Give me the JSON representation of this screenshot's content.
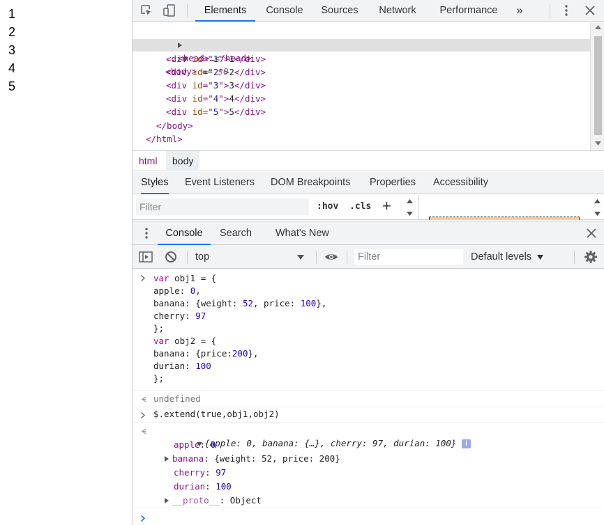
{
  "page": {
    "lines": [
      "1",
      "2",
      "3",
      "4",
      "5"
    ]
  },
  "toolbar": {
    "tabs": [
      "Elements",
      "Console",
      "Sources",
      "Network",
      "Performance"
    ],
    "more": "»"
  },
  "tree": {
    "head_open": "<head>",
    "head_ellipsis": "…",
    "head_close": "</head>",
    "body_dots": "...",
    "body_tag": "<body>",
    "body_eq": " == $0",
    "divs": [
      {
        "id": "1",
        "text": "1"
      },
      {
        "id": "2",
        "text": "2"
      },
      {
        "id": "3",
        "text": "3"
      },
      {
        "id": "4",
        "text": "4"
      },
      {
        "id": "5",
        "text": "5"
      }
    ],
    "body_close": "</body>",
    "html_close": "</html>"
  },
  "breadcrumb": [
    "html",
    "body"
  ],
  "subtabs": [
    "Styles",
    "Event Listeners",
    "DOM Breakpoints",
    "Properties",
    "Accessibility"
  ],
  "styles": {
    "filter_placeholder": "Filter",
    "hov": ":hov",
    "cls": ".cls",
    "plus": "+"
  },
  "drawer": {
    "tabs": [
      "Console",
      "Search",
      "What's New"
    ]
  },
  "console_toolbar": {
    "context": "top",
    "filter_placeholder": "Filter",
    "levels": "Default levels"
  },
  "console": {
    "input1": [
      "var obj1 = {",
      "apple: 0,",
      "banana: {weight: 52, price: 100},",
      "cherry: 97",
      "};",
      "var obj2 = {",
      "banana: {price:200},",
      "durian: 100",
      "};"
    ],
    "result1": "undefined",
    "input2": "$.extend(true,obj1,obj2)",
    "result2_summary": "{apple: 0, banana: {…}, cherry: 97, durian: 100}",
    "result2_props": [
      {
        "key": "apple",
        "value": "0"
      },
      {
        "key": "banana",
        "value": "{weight: 52, price: 200}"
      },
      {
        "key": "cherry",
        "value": "97"
      },
      {
        "key": "durian",
        "value": "100"
      },
      {
        "key": "__proto__",
        "value": "Object"
      }
    ],
    "info": "i"
  },
  "colors": {
    "accent": "#1a73e8",
    "tag": "#881280",
    "attr": "#994500",
    "value": "#1a1aa6",
    "number": "#1c00cf"
  }
}
